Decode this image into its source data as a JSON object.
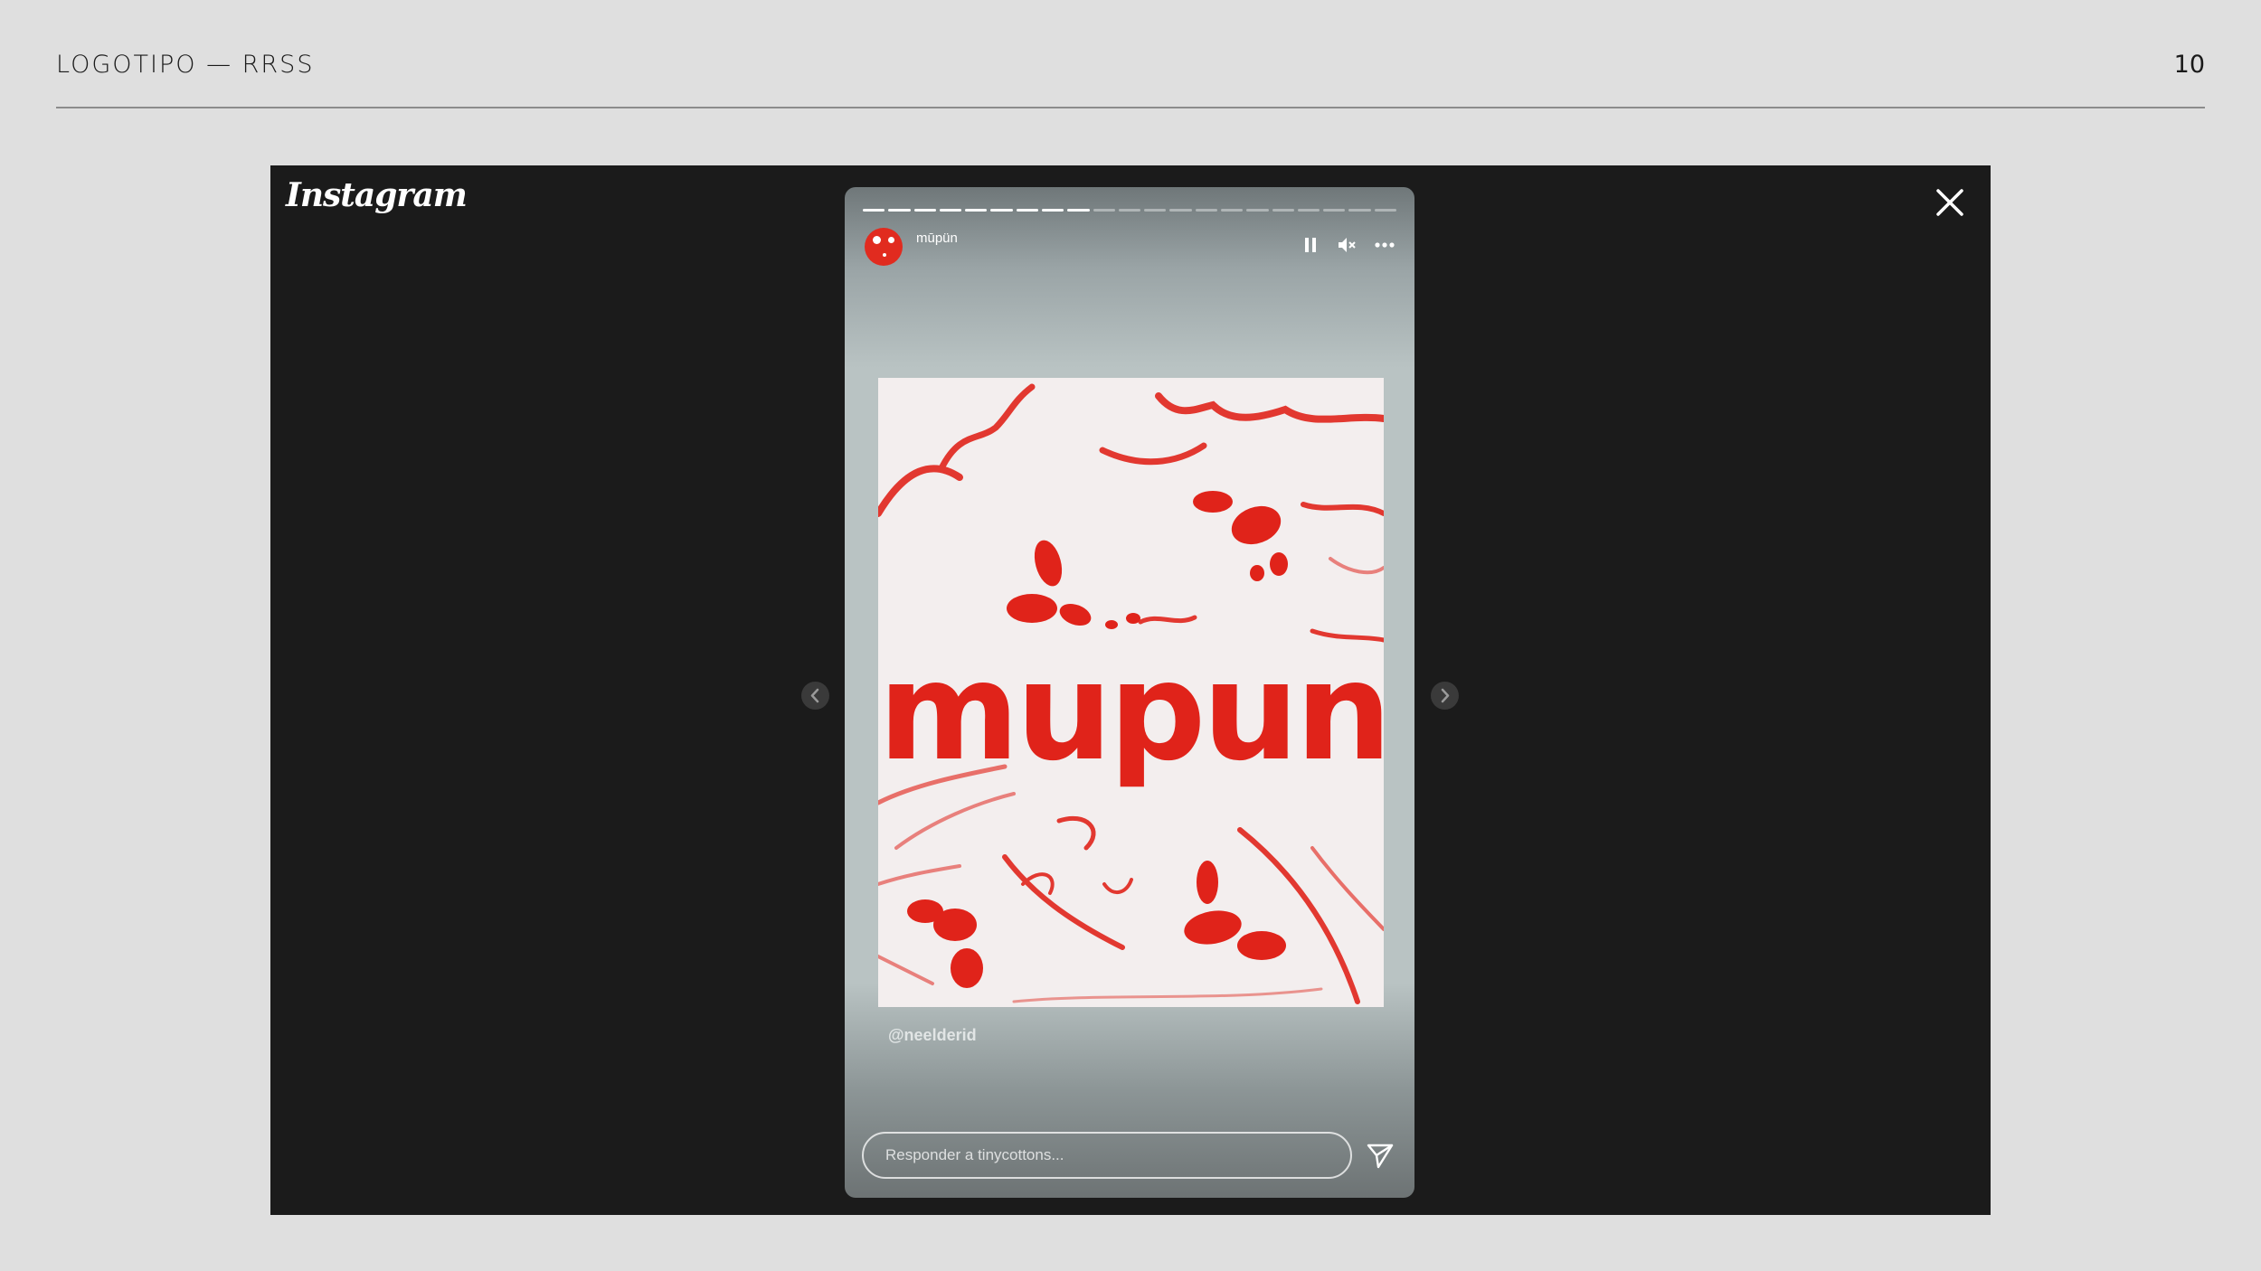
{
  "page": {
    "title": "LOGOTIPO — RRSS",
    "number": "10"
  },
  "instagram": {
    "logo_text": "Instagram",
    "story": {
      "progress": {
        "total_segments": 21,
        "completed_segments": 9
      },
      "username": "mūpün",
      "brand_word": "mupun",
      "mention": "@neelderid",
      "reply_placeholder": "Responder a tinycottons..."
    }
  },
  "colors": {
    "page_bg": "#dfdfdf",
    "viewer_bg": "#1b1b1b",
    "brand_red": "#e0231a",
    "image_bg": "#f3eeee"
  },
  "icons": {
    "close": "close-icon",
    "prev": "chevron-left-icon",
    "next": "chevron-right-icon",
    "pause": "pause-icon",
    "mute": "mute-icon",
    "more": "more-icon",
    "send": "send-icon"
  }
}
